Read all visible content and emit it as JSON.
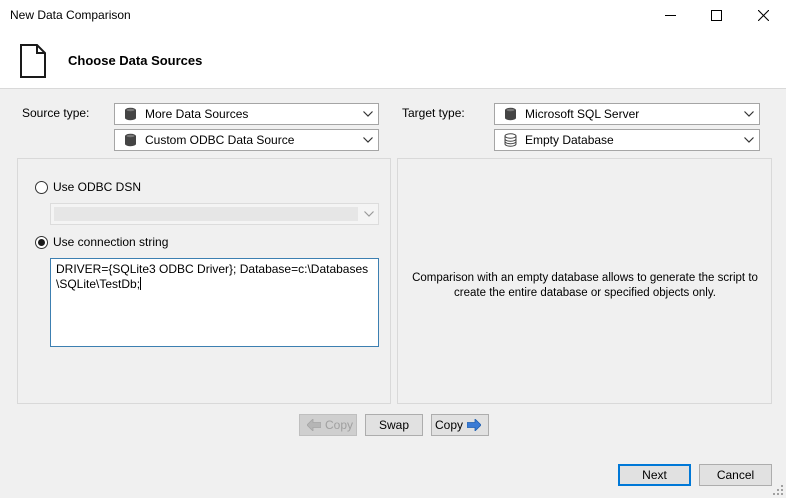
{
  "window": {
    "title": "New Data Comparison"
  },
  "header": {
    "title": "Choose Data Sources"
  },
  "source": {
    "label": "Source type:",
    "type_value": "More Data Sources",
    "subtype_value": "Custom ODBC Data Source"
  },
  "target": {
    "label": "Target type:",
    "type_value": "Microsoft SQL Server",
    "subtype_value": "Empty Database"
  },
  "odbc": {
    "dsn_label": "Use ODBC DSN",
    "dsn_selected": false,
    "connstr_label": "Use connection string",
    "connstr_selected": true,
    "connection_string": "DRIVER={SQLite3 ODBC Driver}; Database=c:\\Databases\n\\SQLite\\TestDb;"
  },
  "info": {
    "text": "Comparison with an empty database allows to generate the script to create the entire database or specified objects only."
  },
  "buttons": {
    "copy_left": "Copy",
    "swap": "Swap",
    "copy_right": "Copy",
    "next": "Next",
    "cancel": "Cancel"
  },
  "colors": {
    "focus_border": "#3c7fb1",
    "default_button_border": "#0078d7",
    "arrow_blue": "#3a7bd5"
  }
}
